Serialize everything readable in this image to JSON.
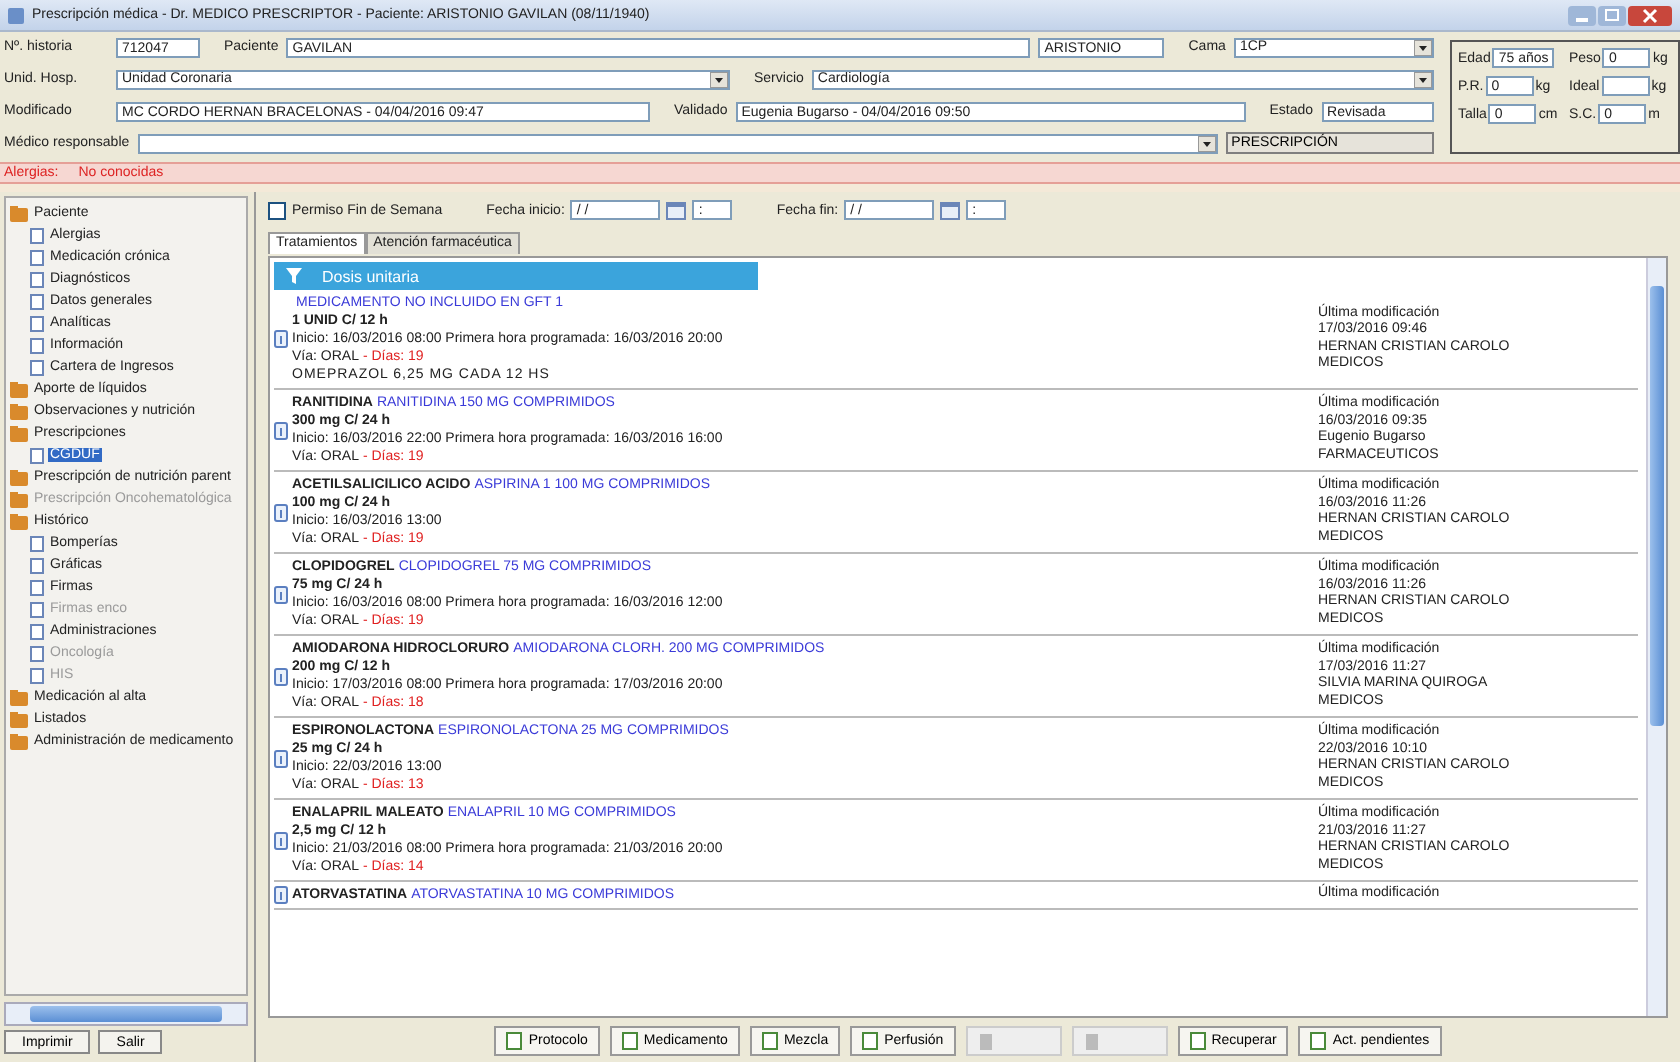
{
  "window": {
    "title": "Prescripción médica - Dr. MEDICO PRESCRIPTOR - Paciente: ARISTONIO GAVILAN (08/11/1940)"
  },
  "header": {
    "rows": [
      [
        {
          "label": "Nº. historia",
          "value": "712047",
          "kind": "text"
        },
        {
          "label": "Paciente",
          "value": "GAVILAN",
          "kind": "text"
        },
        {
          "value": "ARISTONIO",
          "kind": "text"
        },
        {
          "label": "Cama",
          "value": "1CP",
          "kind": "dropdown"
        }
      ],
      [
        {
          "label": "Unid. Hosp.",
          "value": "Unidad Coronaria",
          "kind": "dropdown"
        },
        {
          "label": "Servicio",
          "value": "Cardiología",
          "kind": "dropdown"
        }
      ],
      [
        {
          "label": "Modificado",
          "value": "MC CORDO HERNAN BRACELONAS - 04/04/2016 09:47",
          "kind": "text"
        },
        {
          "label": "Validado",
          "value": "Eugenia Bugarso - 04/04/2016 09:50",
          "kind": "text"
        },
        {
          "label": "Estado",
          "value": "Revisada",
          "kind": "text"
        }
      ],
      [
        {
          "label": "Médico responsable",
          "kind": "dropdown"
        },
        {
          "value": "PRESCRIPCIÓN",
          "kind": "button"
        }
      ]
    ]
  },
  "vitals": [
    {
      "label": "Edad",
      "value": "75 años"
    },
    {
      "label": "Peso",
      "value": "0",
      "unit": "kg"
    },
    {
      "label": "P.R.",
      "value": "0",
      "unit": "kg"
    },
    {
      "label": "Ideal",
      "unit": "kg"
    },
    {
      "label": "Talla",
      "value": "0",
      "unit": "cm"
    },
    {
      "label": "S.C.",
      "value": "0",
      "unit": "m"
    }
  ],
  "alerts": {
    "label": "Alergias:",
    "value": "No conocidas"
  },
  "sidebar": {
    "items": [
      {
        "label": "Paciente",
        "selected": false,
        "disabled": false,
        "children": [
          {
            "label": "Alergias",
            "selected": false,
            "disabled": false
          },
          {
            "label": "Medicación crónica",
            "selected": false,
            "disabled": false
          },
          {
            "label": "Diagnósticos",
            "selected": false,
            "disabled": false
          },
          {
            "label": "Datos generales",
            "selected": false,
            "disabled": false
          },
          {
            "label": "Analíticas",
            "selected": false,
            "disabled": false
          },
          {
            "label": "Información",
            "selected": false,
            "disabled": false
          },
          {
            "label": "Cartera de Ingresos",
            "selected": false,
            "disabled": false
          }
        ]
      },
      {
        "label": "Aporte de líquidos",
        "selected": false,
        "disabled": false
      },
      {
        "label": "Observaciones y nutrición",
        "selected": false,
        "disabled": false
      },
      {
        "label": "Prescripciones",
        "selected": false,
        "disabled": false,
        "children": [
          {
            "label": "CGDUF",
            "selected": true,
            "disabled": false
          }
        ]
      },
      {
        "label": "Prescripción de nutrición parent",
        "selected": false,
        "disabled": false
      },
      {
        "label": "Prescripción Oncohematológica",
        "selected": false,
        "disabled": true
      },
      {
        "label": "Histórico",
        "selected": false,
        "disabled": false,
        "children": [
          {
            "label": "Bomperías",
            "selected": false,
            "disabled": false
          },
          {
            "label": "Gráficas",
            "selected": false,
            "disabled": false
          },
          {
            "label": "Firmas",
            "selected": false,
            "disabled": false
          },
          {
            "label": "Firmas enco",
            "selected": false,
            "disabled": true
          },
          {
            "label": "Administraciones",
            "selected": false,
            "disabled": false
          },
          {
            "label": "Oncología",
            "selected": false,
            "disabled": true
          },
          {
            "label": "HIS",
            "selected": false,
            "disabled": true
          }
        ]
      },
      {
        "label": "Medicación al alta",
        "selected": false,
        "disabled": false
      },
      {
        "label": "Listados",
        "selected": false,
        "disabled": false
      },
      {
        "label": "Administración de medicamento",
        "selected": false,
        "disabled": false
      }
    ],
    "buttons": [
      "Imprimir",
      "Salir"
    ]
  },
  "filters": {
    "weekend": {
      "label": "Permiso Fin de Semana",
      "checked": false
    },
    "start": {
      "label": "Fecha inicio:",
      "date": "/ /",
      "time": ":"
    },
    "end": {
      "label": "Fecha fin:",
      "date": "/ /",
      "time": ":"
    }
  },
  "tabs": [
    {
      "label": "Tratamientos",
      "selected": true
    },
    {
      "label": "Atención farmacéutica",
      "selected": false
    }
  ],
  "group": "Dosis unitaria",
  "treatments": [
    {
      "description": "MEDICAMENTO NO INCLUIDO EN GFT 1",
      "dose": "1 UNID C/ 12 h",
      "start": "Inicio: 16/03/2016 08:00 Primera hora programada: 16/03/2016 20:00",
      "route": "Vía: ORAL",
      "days": "- Días: 19",
      "note": "OMEPRAZOL 6,25 MG CADA 12 HS",
      "modified": [
        "Última modificación",
        "17/03/2016 09:46",
        "HERNAN CRISTIAN CAROLO",
        "MEDICOS"
      ]
    },
    {
      "name": "RANITIDINA",
      "description": "RANITIDINA 150 MG COMPRIMIDOS",
      "dose": "300 mg C/ 24 h",
      "start": "Inicio: 16/03/2016 22:00 Primera hora programada: 16/03/2016 16:00",
      "route": "Vía: ORAL",
      "days": "- Días: 19",
      "modified": [
        "Última modificación",
        "16/03/2016 09:35",
        "Eugenio Bugarso",
        "FARMACEUTICOS"
      ]
    },
    {
      "name": "ACETILSALICILICO ACIDO",
      "description": "ASPIRINA 1 100 MG COMPRIMIDOS",
      "dose": "100 mg C/ 24 h",
      "start": "Inicio: 16/03/2016 13:00",
      "route": "Vía: ORAL",
      "days": "- Días: 19",
      "modified": [
        "Última modificación",
        "16/03/2016 11:26",
        "HERNAN CRISTIAN CAROLO",
        "MEDICOS"
      ]
    },
    {
      "name": "CLOPIDOGREL",
      "description": "CLOPIDOGREL 75 MG COMPRIMIDOS",
      "dose": "75 mg C/ 24 h",
      "start": "Inicio: 16/03/2016 08:00 Primera hora programada: 16/03/2016 12:00",
      "route": "Vía: ORAL",
      "days": "- Días: 19",
      "modified": [
        "Última modificación",
        "16/03/2016 11:26",
        "HERNAN CRISTIAN CAROLO",
        "MEDICOS"
      ]
    },
    {
      "name": "AMIODARONA HIDROCLORURO",
      "description": "AMIODARONA CLORH. 200 MG COMPRIMIDOS",
      "dose": "200 mg C/ 12 h",
      "start": "Inicio: 17/03/2016 08:00 Primera hora programada: 17/03/2016 20:00",
      "route": "Vía: ORAL",
      "days": "- Días: 18",
      "modified": [
        "Última modificación",
        "17/03/2016 11:27",
        "SILVIA MARINA QUIROGA",
        "MEDICOS"
      ]
    },
    {
      "name": "ESPIRONOLACTONA",
      "description": "ESPIRONOLACTONA 25 MG COMPRIMIDOS",
      "dose": "25 mg C/ 24 h",
      "start": "Inicio: 22/03/2016 13:00",
      "route": "Vía: ORAL",
      "days": "- Días: 13",
      "modified": [
        "Última modificación",
        "22/03/2016 10:10",
        "HERNAN CRISTIAN CAROLO",
        "MEDICOS"
      ]
    },
    {
      "name": "ENALAPRIL MALEATO",
      "description": "ENALAPRIL 10 MG COMPRIMIDOS",
      "dose": "2,5 mg C/ 12 h",
      "start": "Inicio: 21/03/2016 08:00 Primera hora programada: 21/03/2016 20:00",
      "route": "Vía: ORAL",
      "days": "- Días: 14",
      "modified": [
        "Última modificación",
        "21/03/2016 11:27",
        "HERNAN CRISTIAN CAROLO",
        "MEDICOS"
      ]
    },
    {
      "name": "ATORVASTATINA",
      "description": "ATORVASTATINA 10 MG COMPRIMIDOS",
      "modified": [
        "Última modificación"
      ]
    }
  ],
  "actions": [
    {
      "label": "Protocolo",
      "disabled": false
    },
    {
      "label": "Medicamento",
      "disabled": false
    },
    {
      "label": "Mezcla",
      "disabled": false
    },
    {
      "label": "Perfusión",
      "disabled": false
    },
    {
      "disabled": true
    },
    {
      "disabled": true
    },
    {
      "label": "Recuperar",
      "disabled": false
    },
    {
      "label": "Act. pendientes",
      "disabled": false
    }
  ]
}
